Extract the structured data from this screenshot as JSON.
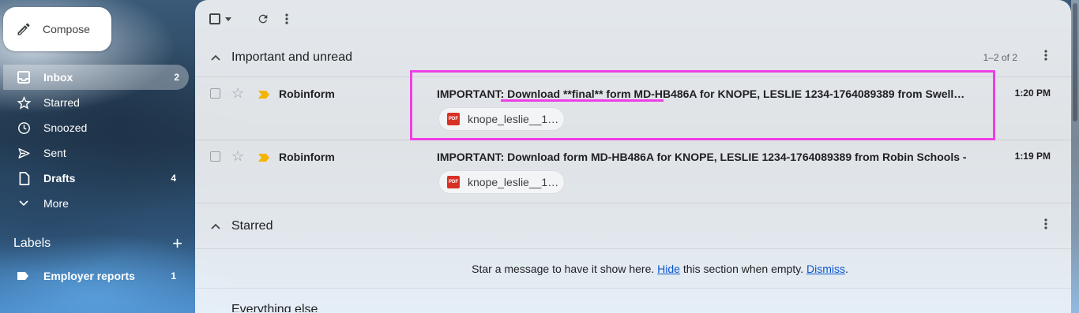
{
  "sidebar": {
    "compose_label": "Compose",
    "nav": [
      {
        "label": "Inbox",
        "count": "2",
        "icon": "inbox-icon",
        "active": true
      },
      {
        "label": "Starred",
        "count": "",
        "icon": "star-icon"
      },
      {
        "label": "Snoozed",
        "count": "",
        "icon": "clock-icon"
      },
      {
        "label": "Sent",
        "count": "",
        "icon": "send-icon"
      },
      {
        "label": "Drafts",
        "count": "4",
        "icon": "draft-icon"
      },
      {
        "label": "More",
        "count": "",
        "icon": "chevron-down-icon"
      }
    ],
    "labels_title": "Labels",
    "labels": [
      {
        "label": "Employer reports",
        "count": "1",
        "icon": "label-icon"
      }
    ]
  },
  "toolbar": {
    "icons": [
      "select-checkbox-icon",
      "dropdown-arrow-icon",
      "refresh-icon",
      "more-vert-icon"
    ]
  },
  "sections": {
    "important": {
      "title": "Important and unread",
      "range": "1–2 of 2",
      "rows": [
        {
          "sender": "Robinform",
          "subject": "IMPORTANT: Download **final** form MD-HB486A for KNOPE, LESLIE 1234-1764089389 from Swell…",
          "time": "1:20 PM",
          "attachment": "knope_leslie__1…",
          "attachment_type": "PDF"
        },
        {
          "sender": "Robinform",
          "subject": "IMPORTANT: Download form MD-HB486A for KNOPE, LESLIE 1234-1764089389 from Robin Schools -",
          "time": "1:19 PM",
          "attachment": "knope_leslie__1…",
          "attachment_type": "PDF"
        }
      ]
    },
    "starred": {
      "title": "Starred",
      "empty_prefix": "Star a message to have it show here.",
      "hide_link": "Hide",
      "empty_middle": "this section when empty.",
      "dismiss_link": "Dismiss",
      "empty_suffix": "."
    },
    "everything": {
      "title": "Everything else"
    }
  },
  "colors": {
    "highlight": "#ee3ee6",
    "important_marker": "#f4b400",
    "link": "#0b57d0",
    "pdf_badge": "#d93025"
  }
}
